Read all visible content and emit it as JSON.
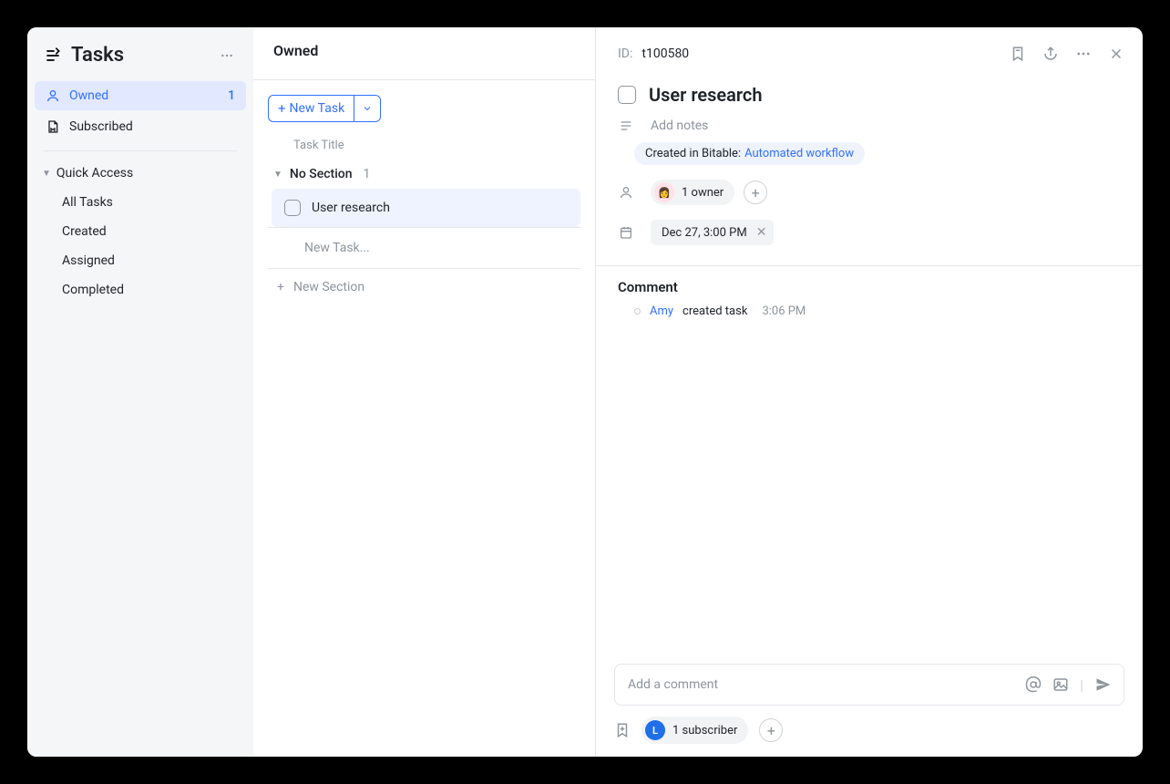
{
  "sidebar": {
    "title": "Tasks",
    "owned": {
      "label": "Owned",
      "count": "1"
    },
    "subscribed": {
      "label": "Subscribed"
    },
    "quick_access": {
      "label": "Quick Access",
      "items": [
        "All Tasks",
        "Created",
        "Assigned",
        "Completed"
      ]
    }
  },
  "list": {
    "header": "Owned",
    "new_task_button": "New Task",
    "column_header": "Task Title",
    "section": {
      "name": "No Section",
      "count": "1"
    },
    "tasks": [
      {
        "title": "User research",
        "done": false
      }
    ],
    "new_task_placeholder": "New Task...",
    "new_section_label": "New Section"
  },
  "detail": {
    "id_label": "ID:",
    "id_value": "t100580",
    "title": "User research",
    "notes_placeholder": "Add notes",
    "origin_prefix": "Created in Bitable:",
    "origin_link": "Automated workflow",
    "owner_pill": "1 owner",
    "due": "Dec 27, 3:00 PM",
    "comment_header": "Comment",
    "comments": [
      {
        "who": "Amy",
        "action": "created task",
        "time": "3:06 PM"
      }
    ],
    "comment_placeholder": "Add a comment",
    "subscriber_pill": "1 subscriber",
    "subscriber_initial": "L"
  }
}
